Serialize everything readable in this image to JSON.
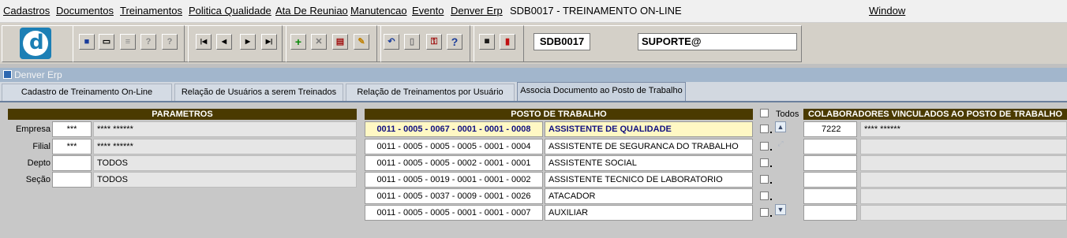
{
  "menu": {
    "items": [
      "Cadastros",
      "Documentos",
      "Treinamentos",
      "Politica Qualidade",
      "Ata De Reuniao",
      "Manutencao",
      "Evento",
      "Denver Erp",
      "SDB0017 - TREINAMENTO ON-LINE"
    ],
    "window": "Window"
  },
  "toolbar": {
    "form_code": "SDB0017",
    "user": "SUPORTE@",
    "buttons": [
      "save",
      "screen",
      "print",
      "help-query",
      "help-query2",
      "first",
      "previous",
      "next",
      "last",
      "insert",
      "delete",
      "query",
      "edit",
      "undo",
      "clipboard",
      "keys",
      "help",
      "menu",
      "exit"
    ]
  },
  "window": {
    "title": "Denver Erp"
  },
  "tabs": [
    "Cadastro de Treinamento On-Line",
    "Relação de Usuários a serem Treinados",
    "Relação de Treinamentos por Usuário",
    "Associa Documento ao Posto de Trabalho"
  ],
  "parametros": {
    "header": "PARAMETROS",
    "rows": [
      {
        "label": "Empresa",
        "code": "***",
        "desc": "**** ******"
      },
      {
        "label": "Filial",
        "code": "***",
        "desc": "**** ******"
      },
      {
        "label": "Depto",
        "code": "",
        "desc": "TODOS"
      },
      {
        "label": "Seção",
        "code": "",
        "desc": "TODOS"
      }
    ]
  },
  "posto": {
    "header": "POSTO DE TRABALHO",
    "rows": [
      {
        "code": "0011 - 0005 - 0067 - 0001 - 0001 - 0008",
        "name": "ASSISTENTE DE QUALIDADE"
      },
      {
        "code": "0011 - 0005 - 0005 - 0005 - 0001 - 0004",
        "name": "ASSISTENTE DE SEGURANCA DO TRABALHO"
      },
      {
        "code": "0011 - 0005 - 0005 - 0002 - 0001 - 0001",
        "name": "ASSISTENTE SOCIAL"
      },
      {
        "code": "0011 - 0005 - 0019 - 0001 - 0001 - 0002",
        "name": "ASSISTENTE TECNICO DE LABORATORIO"
      },
      {
        "code": "0011 - 0005 - 0037 - 0009 - 0001 - 0026",
        "name": "ATACADOR"
      },
      {
        "code": "0011 - 0005 - 0005 - 0001 - 0001 - 0007",
        "name": "AUXILIAR"
      }
    ]
  },
  "todos_label": "Todos",
  "colaboradores": {
    "header": "COLABORADORES VINCULADOS AO POSTO DE TRABALHO",
    "rows": [
      {
        "code": "7222",
        "name": "**** ******"
      },
      {
        "code": "",
        "name": ""
      },
      {
        "code": "",
        "name": ""
      },
      {
        "code": "",
        "name": ""
      },
      {
        "code": "",
        "name": ""
      },
      {
        "code": "",
        "name": ""
      }
    ]
  },
  "colors": {
    "header_bg": "#4a3a00",
    "selected_bg": "#fff8c4",
    "selected_text": "#101080"
  }
}
